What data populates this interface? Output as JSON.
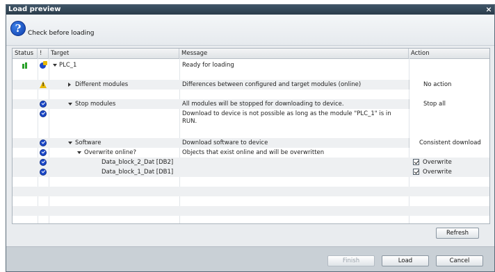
{
  "window": {
    "title": "Load preview",
    "close_label": "×"
  },
  "header": {
    "text": "Check before loading"
  },
  "columns": {
    "status": "Status",
    "flag": "!",
    "target": "Target",
    "message": "Message",
    "action": "Action"
  },
  "rows": [
    {
      "target": "PLC_1",
      "message": "Ready for loading",
      "action": ""
    },
    {
      "target": "Different modules",
      "message": "Differences between configured and target modules (online)",
      "action": "No action"
    },
    {
      "target": "Stop modules",
      "message": "All modules will be stopped for downloading to device.",
      "action": "Stop all"
    },
    {
      "target": "",
      "message": "Download to device is not possible as long as the module \"PLC_1\" is in RUN.",
      "action": ""
    },
    {
      "target": "Software",
      "message": "Download software to device",
      "action": "Consistent download"
    },
    {
      "target": "Overwrite online?",
      "message": "Objects that exist online and will be overwritten",
      "action": ""
    },
    {
      "target": "Data_block_2_Dat [DB2]",
      "message": "",
      "action": "Overwrite"
    },
    {
      "target": "Data_block_1_Dat [DB1]",
      "message": "",
      "action": "Overwrite"
    }
  ],
  "buttons": {
    "refresh": "Refresh",
    "finish": "Finish",
    "load": "Load",
    "cancel": "Cancel"
  },
  "icons": {
    "help": "question-icon",
    "status_ok": "status-online-icon",
    "plc": "plc-icon",
    "warning": "warning-icon",
    "check": "ok-check-icon"
  },
  "colors": {
    "titlebar": "#2b3c4a",
    "ok_blue": "#1b48c8",
    "warning": "#e8b800",
    "status_green": "#2aa02a"
  }
}
